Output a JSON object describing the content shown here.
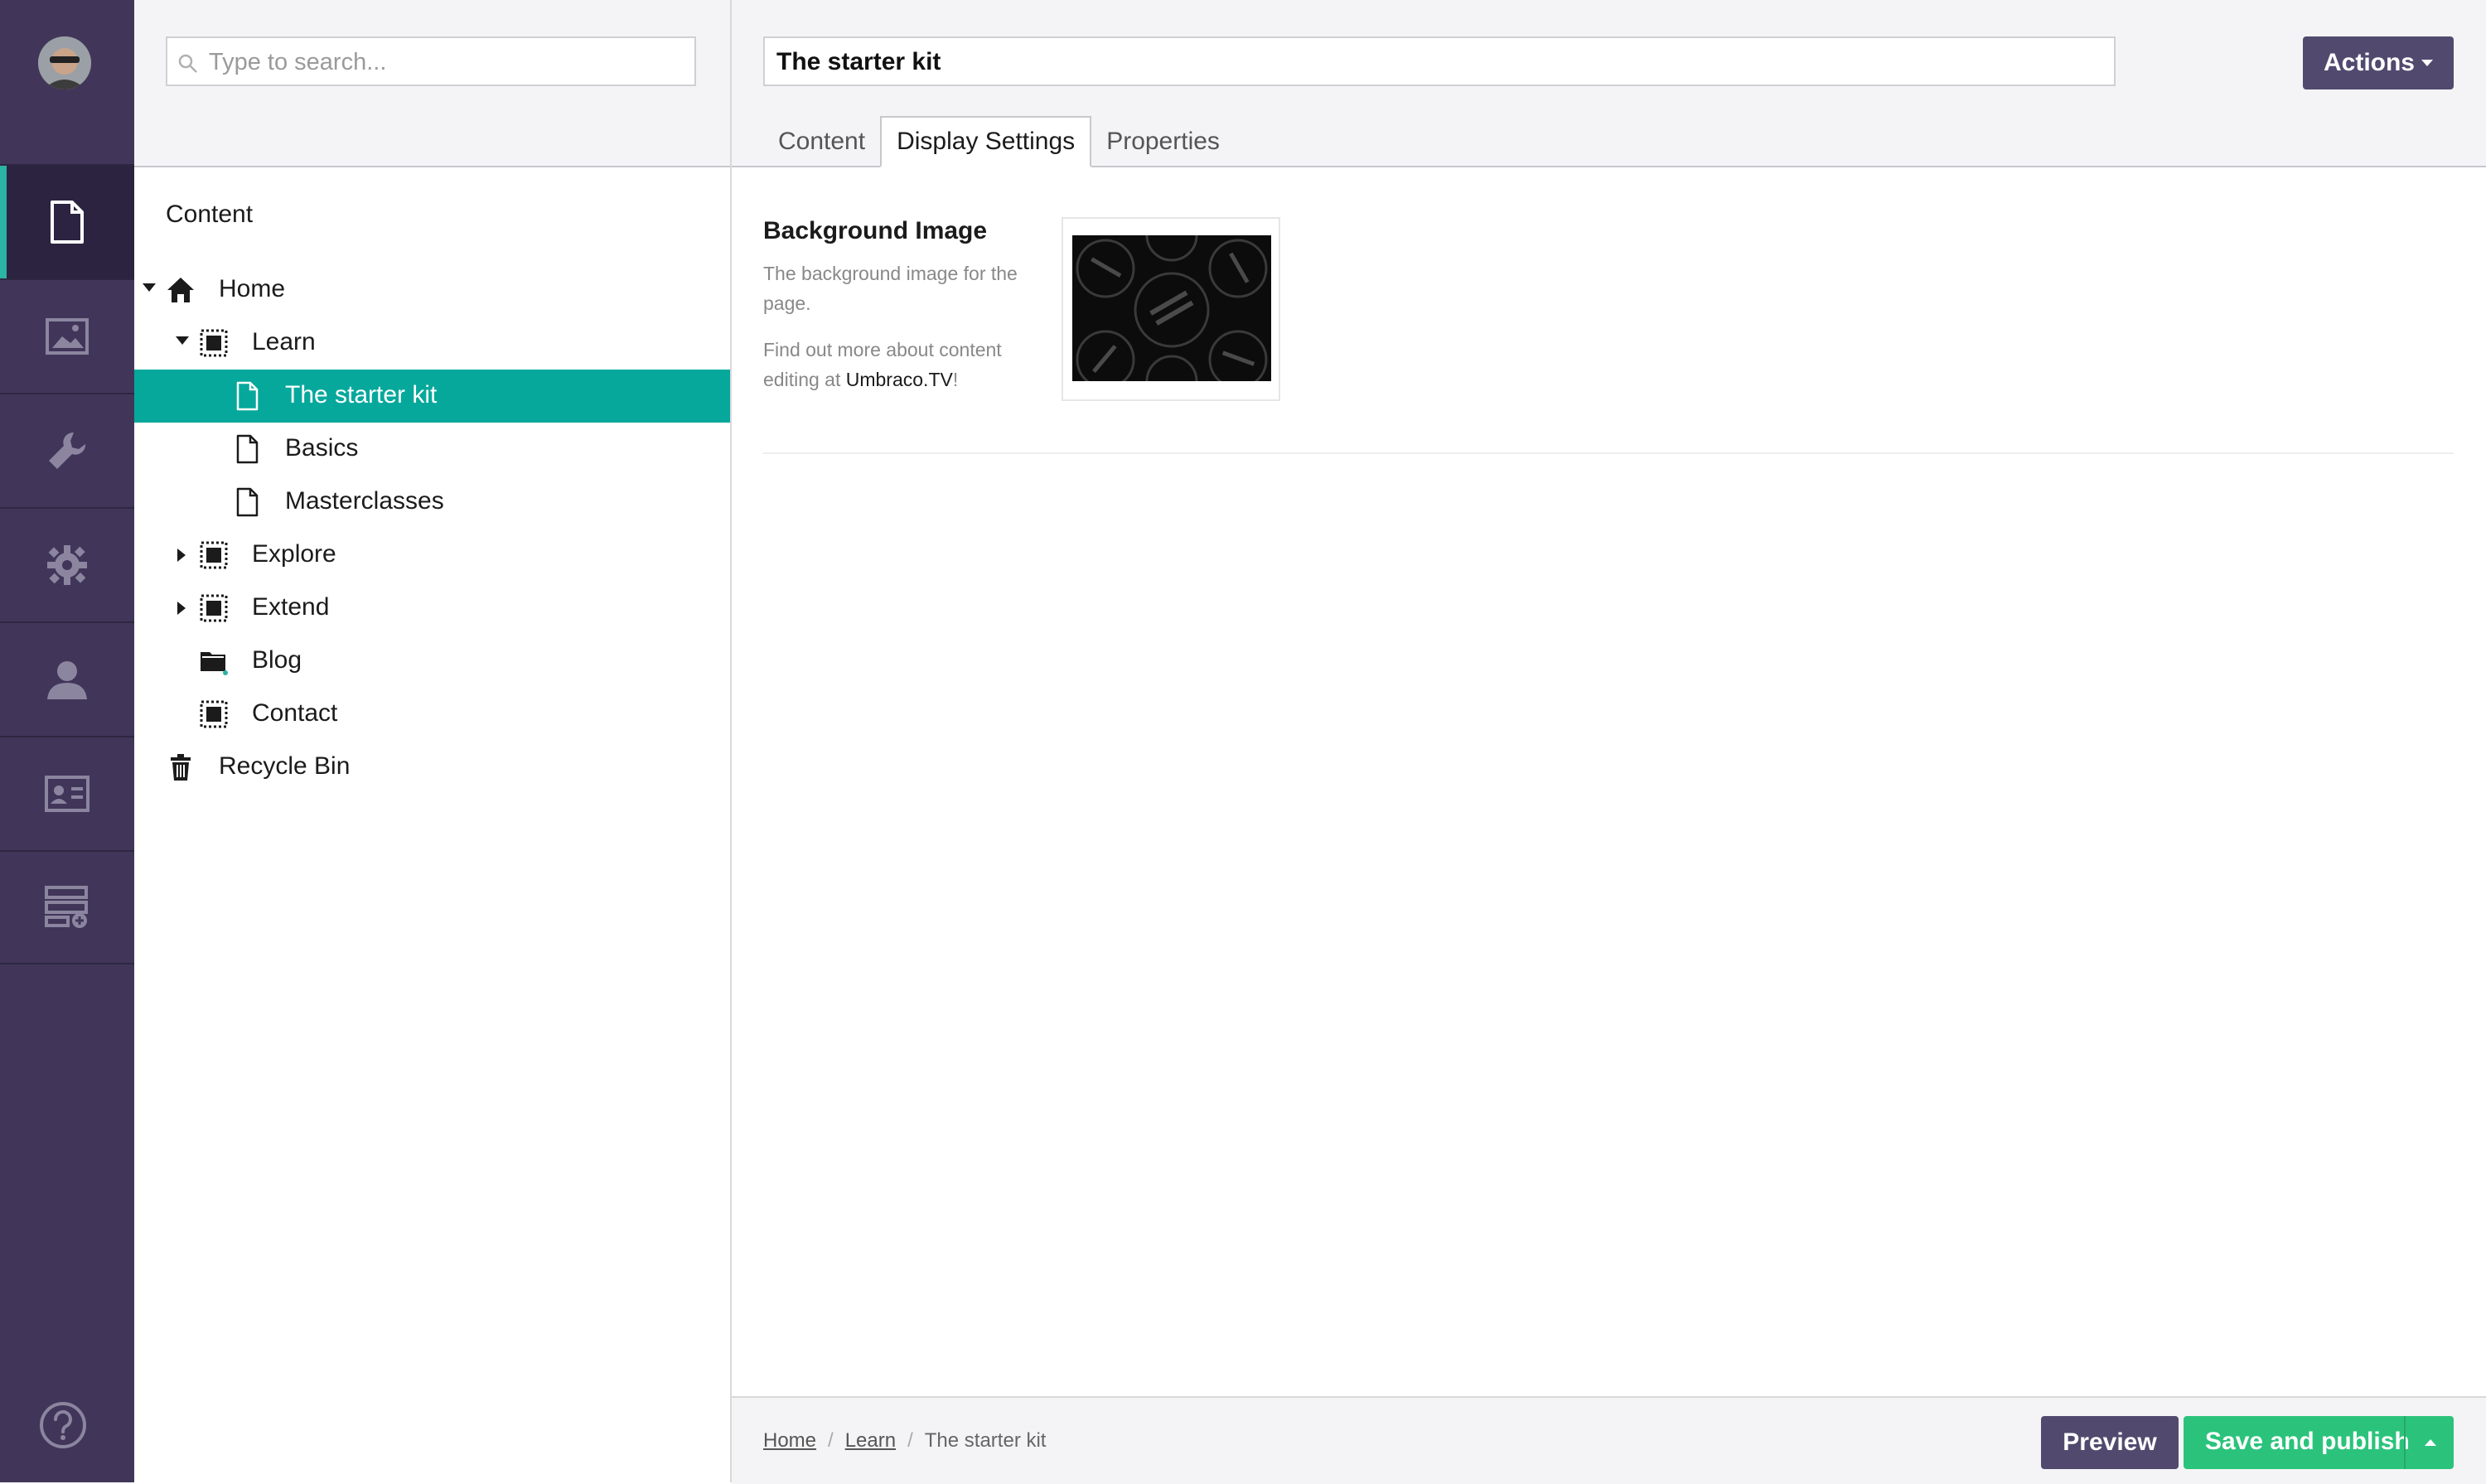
{
  "search": {
    "placeholder": "Type to search..."
  },
  "tree": {
    "title": "Content",
    "nodes": [
      {
        "label": "Home",
        "icon": "home-icon"
      },
      {
        "label": "Learn",
        "icon": "grid-icon"
      },
      {
        "label": "The starter kit",
        "icon": "document-icon"
      },
      {
        "label": "Basics",
        "icon": "document-icon"
      },
      {
        "label": "Masterclasses",
        "icon": "document-icon"
      },
      {
        "label": "Explore",
        "icon": "grid-icon"
      },
      {
        "label": "Extend",
        "icon": "grid-icon"
      },
      {
        "label": "Blog",
        "icon": "folder-icon"
      },
      {
        "label": "Contact",
        "icon": "grid-icon"
      },
      {
        "label": "Recycle Bin",
        "icon": "trash-icon"
      }
    ]
  },
  "rail": {
    "sections": [
      "document-icon",
      "image-icon",
      "wrench-icon",
      "gear-icon",
      "user-icon",
      "id-card-icon",
      "form-icon"
    ],
    "help_icon": "help-icon"
  },
  "editor": {
    "name_value": "The starter kit",
    "actions_label": "Actions",
    "tabs": [
      "Content",
      "Display Settings",
      "Properties"
    ],
    "property": {
      "label": "Background Image",
      "description": "The background image for the page.",
      "help_prefix": "Find out more about content editing at ",
      "help_link": "Umbraco.TV",
      "help_suffix": "!"
    }
  },
  "footer": {
    "breadcrumb": [
      "Home",
      "Learn",
      "The starter kit"
    ],
    "preview_label": "Preview",
    "publish_label": "Save and publish"
  },
  "colors": {
    "rail": "#413659",
    "selected": "#06a89c",
    "accent": "#2bb3a3",
    "publish": "#2bc37c",
    "button": "#514a6e"
  }
}
